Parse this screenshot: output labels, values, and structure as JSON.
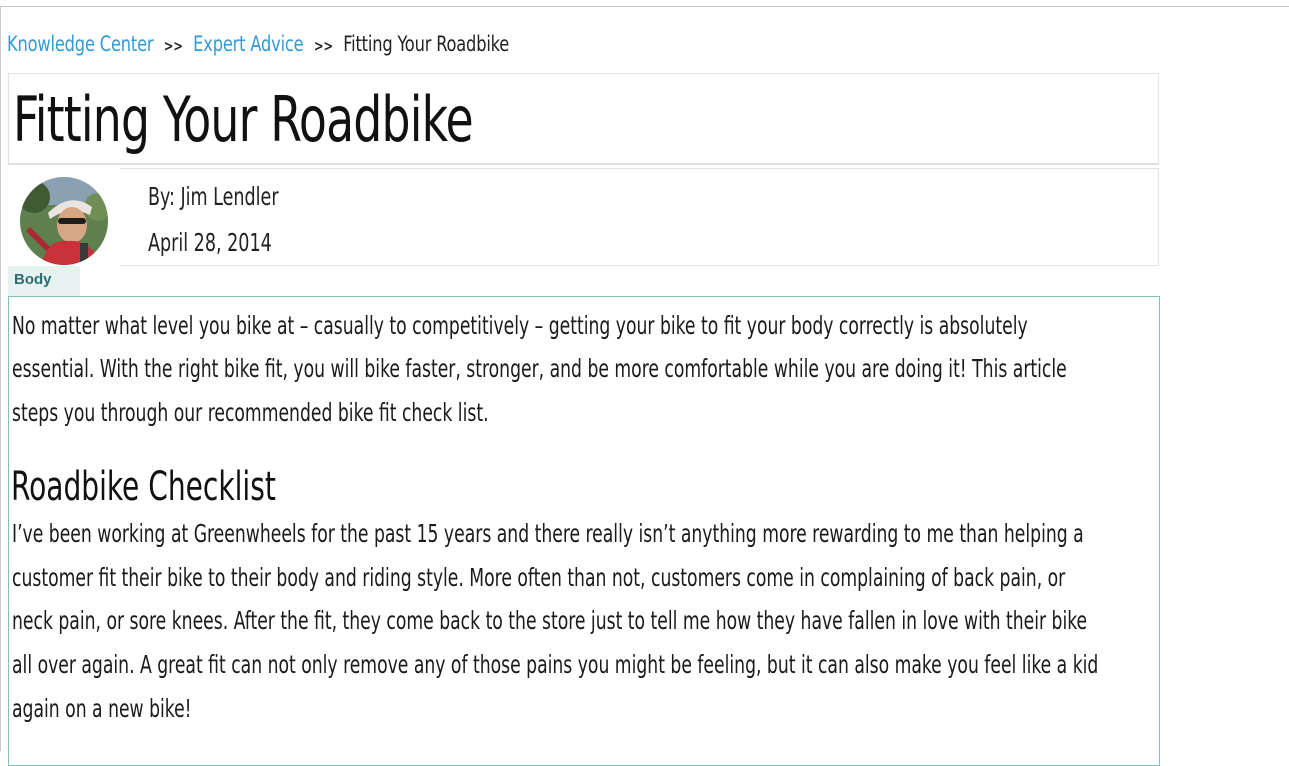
{
  "breadcrumb": {
    "item1": "Knowledge Center",
    "separator": ">>",
    "item2": "Expert Advice",
    "current": "Fitting Your Roadbike"
  },
  "article": {
    "title": "Fitting Your Roadbike",
    "author": "By: Jim Lendler",
    "date": "April 28, 2014",
    "section_tab": "Body",
    "intro_lines": [
      "No matter what level you bike at – casually to competitively – getting your bike to fit your body correctly is absolutely",
      "essential. With the right bike fit, you will bike faster, stronger, and be more comfortable while you are doing it! This article",
      "steps you through our recommended bike fit check list."
    ],
    "heading": "Roadbike Checklist",
    "body_lines": [
      "I’ve been working at Greenwheels for the past 15 years and there really isn’t anything more rewarding to me than helping a",
      "customer fit their bike to their body and riding style. More often than not, customers come in complaining of back pain, or",
      "neck pain, or sore knees. After the fit, they come back to the store just to tell me how they have fallen in love with their bike",
      "all over again. A great fit can not only remove any of those pains you might be feeling, but it can also make you feel like a kid",
      "again on a new bike!"
    ]
  },
  "colors": {
    "link": "#2f9bd6",
    "tab_bg": "#e5f2f0",
    "tab_text": "#2b6f73",
    "content_border": "#7ec4b6"
  },
  "icons": {
    "avatar": "author-photo-avatar"
  }
}
